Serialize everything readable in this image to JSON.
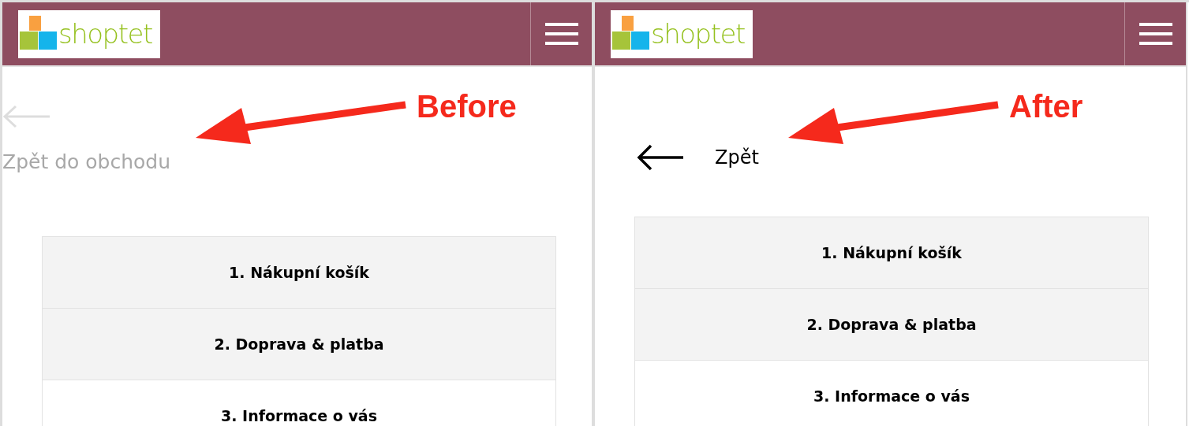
{
  "panels": [
    {
      "logo": {
        "text": "shoptet"
      },
      "back_link": {
        "kind": "stacked",
        "label": "Zpět do obchodu"
      },
      "annotation": {
        "label": "Before"
      },
      "steps": [
        {
          "label": "1. Nákupní košík",
          "shaded": true
        },
        {
          "label": "2. Doprava & platba",
          "shaded": true
        },
        {
          "label": "3. Informace o vás",
          "shaded": false
        }
      ]
    },
    {
      "logo": {
        "text": "shoptet"
      },
      "back_link": {
        "kind": "inline",
        "label": "Zpět"
      },
      "annotation": {
        "label": "After"
      },
      "steps": [
        {
          "label": "1. Nákupní košík",
          "shaded": true
        },
        {
          "label": "2. Doprava & platba",
          "shaded": true
        },
        {
          "label": "3. Informace o vás",
          "shaded": false
        }
      ]
    }
  ]
}
